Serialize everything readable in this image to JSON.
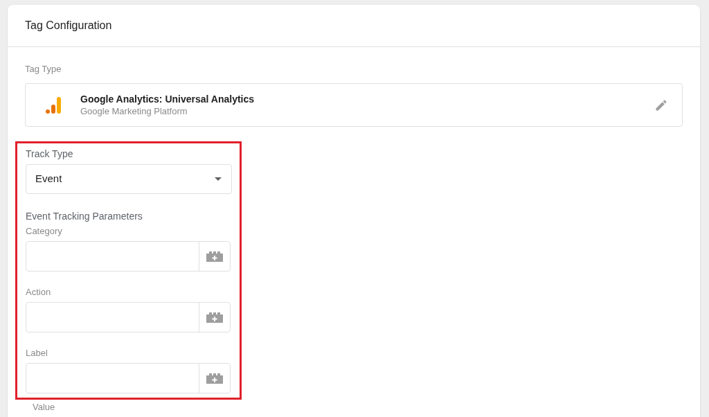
{
  "card": {
    "title": "Tag Configuration"
  },
  "tag_type": {
    "label": "Tag Type",
    "name": "Google Analytics: Universal Analytics",
    "provider": "Google Marketing Platform"
  },
  "track_type": {
    "label": "Track Type",
    "value": "Event"
  },
  "parameters": {
    "heading": "Event Tracking Parameters",
    "fields": [
      {
        "label": "Category"
      },
      {
        "label": "Action"
      },
      {
        "label": "Label"
      }
    ]
  },
  "next_field": {
    "label": "Value"
  }
}
